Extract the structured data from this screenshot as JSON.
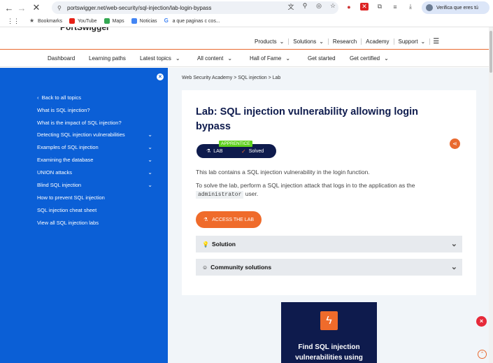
{
  "browser": {
    "url": "portswigger.net/web-security/sql-injection/lab-login-bypass",
    "profile_label": "Verifica que eres tú",
    "bookmarks": [
      {
        "label": "Bookmarks",
        "color": "#555555"
      },
      {
        "label": "YouTube",
        "color": "#e62117"
      },
      {
        "label": "Maps",
        "color": "#34a853"
      },
      {
        "label": "Noticias",
        "color": "#4285f4"
      },
      {
        "label": "a que paginas c cos...",
        "color": "#4285f4"
      }
    ]
  },
  "header": {
    "logo_text": "PortSwigger",
    "top_nav": [
      {
        "label": "Products",
        "has_chevron": true
      },
      {
        "label": "Solutions",
        "has_chevron": true
      },
      {
        "label": "Research",
        "has_chevron": false
      },
      {
        "label": "Academy",
        "has_chevron": false
      },
      {
        "label": "Support",
        "has_chevron": true
      }
    ],
    "sub_nav": [
      {
        "label": "Dashboard",
        "has_chevron": false
      },
      {
        "label": "Learning paths",
        "has_chevron": false
      },
      {
        "label": "Latest topics",
        "has_chevron": true
      },
      {
        "label": "All content",
        "has_chevron": true
      },
      {
        "label": "Hall of Fame",
        "has_chevron": true
      },
      {
        "label": "Get started",
        "has_chevron": false
      },
      {
        "label": "Get certified",
        "has_chevron": true
      }
    ]
  },
  "sidebar": {
    "items": [
      {
        "label": "Back to all topics",
        "back": true,
        "has_chevron": false
      },
      {
        "label": "What is SQL injection?",
        "has_chevron": false
      },
      {
        "label": "What is the impact of SQL injection?",
        "has_chevron": false
      },
      {
        "label": "Detecting SQL injection vulnerabilities",
        "has_chevron": true
      },
      {
        "label": "Examples of SQL injection",
        "has_chevron": true
      },
      {
        "label": "Examining the database",
        "has_chevron": true
      },
      {
        "label": "UNION attacks",
        "has_chevron": true
      },
      {
        "label": "Blind SQL injection",
        "has_chevron": true
      },
      {
        "label": "How to prevent SQL injection",
        "has_chevron": false
      },
      {
        "label": "SQL injection cheat sheet",
        "has_chevron": false
      },
      {
        "label": "View all SQL injection labs",
        "has_chevron": false
      }
    ]
  },
  "main": {
    "breadcrumb": [
      "Web Security Academy",
      "SQL injection",
      "Lab"
    ],
    "breadcrumb_sep": ">",
    "title": "Lab: SQL injection vulnerability allowing login bypass",
    "level": "APPRENTICE",
    "lab_label": "LAB",
    "status": "Solved",
    "description_1": "This lab contains a SQL injection vulnerability in the login function.",
    "description_2_before": "To solve the lab, perform a SQL injection attack that logs in to the application as the",
    "description_2_code": "administrator",
    "description_2_after": "user.",
    "access_button": "ACCESS THE LAB",
    "accordions": [
      {
        "label": "Solution"
      },
      {
        "label": "Community solutions"
      }
    ],
    "promo_text": "Find SQL injection vulnerabilities using"
  },
  "colors": {
    "sidebar_bg": "#0b5fd6",
    "accent_orange": "#ef6b2b",
    "navy": "#0e1b4d",
    "apprentice_green": "#5fd11e"
  }
}
